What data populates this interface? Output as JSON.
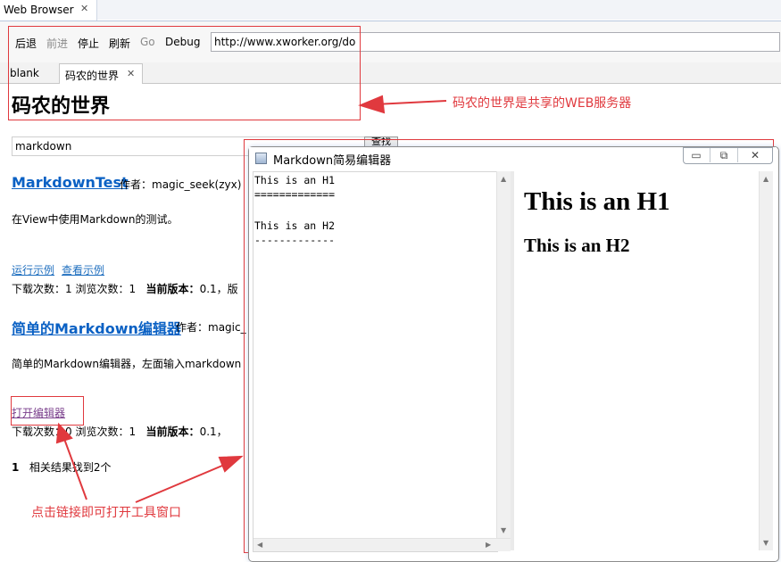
{
  "view": {
    "title": "Web Browser",
    "close_glyph": "✕"
  },
  "toolbar": {
    "back": "后退",
    "forward": "前进",
    "stop": "停止",
    "refresh": "刷新",
    "go": "Go",
    "debug": "Debug",
    "url": "http://www.xworker.org/do"
  },
  "tabs": [
    {
      "label": "blank",
      "active": false
    },
    {
      "label": "码农的世界",
      "active": true,
      "close_glyph": "✕"
    }
  ],
  "page": {
    "title": "码农的世界",
    "search": {
      "value": "markdown",
      "button": "查找"
    },
    "results": [
      {
        "title": "MarkdownTest",
        "author": "作者：magic_seek(zyx)",
        "description": "在View中使用Markdown的测试。",
        "links": [
          "运行示例",
          "查看示例"
        ],
        "meta": {
          "prefix": "下载次数：1 浏览次数：1",
          "version_label": "当前版本：",
          "version_value": "0.1，版"
        }
      },
      {
        "title": "简单的Markdown编辑器",
        "author": "作者：magic_",
        "description": "简单的Markdown编辑器，左面输入markdown",
        "links": [
          "打开编辑器"
        ],
        "meta": {
          "prefix": "下载次数：0 浏览次数：1",
          "version_label": "当前版本：",
          "version_value": "0.1，"
        }
      }
    ],
    "summary": {
      "page": "1",
      "text": "相关结果找到2个"
    }
  },
  "annotations": {
    "top": "码农的世界是共享的WEB服务器",
    "bottom": "点击链接即可打开工具窗口",
    "color": "#e0393e"
  },
  "editor": {
    "title": "Markdown简易编辑器",
    "controls": {
      "minimize": "▭",
      "restore": "⧉",
      "close": "✕"
    },
    "source_lines": [
      "This is an H1",
      "=============",
      "",
      "This is an H2",
      "-------------"
    ],
    "preview": {
      "h1": "This is an H1",
      "h2": "This is an H2"
    }
  }
}
